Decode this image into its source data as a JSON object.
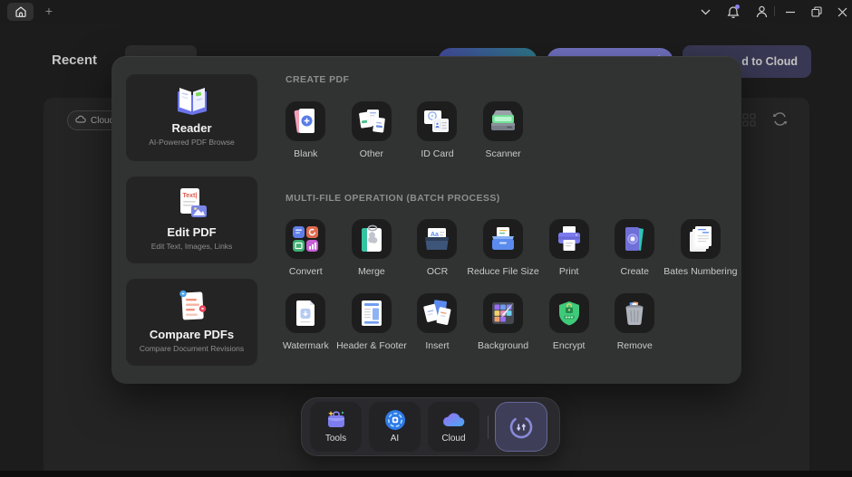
{
  "titlebar": {
    "plus_label": "+",
    "icons": [
      "home-icon",
      "chevron-down-icon",
      "notifications-bell-icon",
      "account-icon",
      "minimize-icon",
      "restore-icon",
      "close-icon"
    ]
  },
  "page": {
    "title": "Recent",
    "cloud_filter_label": "Cloud",
    "upload_to_cloud_button_partial_label": "d to Cloud"
  },
  "modal": {
    "cards": [
      {
        "title": "Reader",
        "subtitle": "AI-Powered PDF Browse",
        "icon": "reader-icon"
      },
      {
        "title": "Edit PDF",
        "subtitle": "Edit Text, Images, Links",
        "icon": "edit-pdf-icon"
      },
      {
        "title": "Compare PDFs",
        "subtitle": "Compare Document Revisions",
        "icon": "compare-pdfs-icon"
      }
    ],
    "create_section": {
      "header": "CREATE PDF",
      "items": [
        {
          "label": "Blank",
          "icon": "blank-icon"
        },
        {
          "label": "Other",
          "icon": "other-icon"
        },
        {
          "label": "ID Card",
          "icon": "id-card-icon"
        },
        {
          "label": "Scanner",
          "icon": "scanner-icon"
        }
      ]
    },
    "batch_section": {
      "header": "MULTI-FILE OPERATION (BATCH PROCESS)",
      "row1": [
        {
          "label": "Convert",
          "icon": "convert-icon"
        },
        {
          "label": "Merge",
          "icon": "merge-icon"
        },
        {
          "label": "OCR",
          "icon": "ocr-icon"
        },
        {
          "label": "Reduce File Size",
          "icon": "reduce-file-size-icon"
        },
        {
          "label": "Print",
          "icon": "print-icon"
        },
        {
          "label": "Create",
          "icon": "create-icon"
        },
        {
          "label": "Bates Numbering",
          "icon": "bates-numbering-icon"
        }
      ],
      "row2": [
        {
          "label": "Watermark",
          "icon": "watermark-icon"
        },
        {
          "label": "Header & Footer",
          "icon": "header-footer-icon"
        },
        {
          "label": "Insert",
          "icon": "insert-icon"
        },
        {
          "label": "Background",
          "icon": "background-icon"
        },
        {
          "label": "Encrypt",
          "icon": "encrypt-icon"
        },
        {
          "label": "Remove",
          "icon": "remove-icon"
        }
      ]
    }
  },
  "dock": {
    "items": [
      {
        "label": "Tools",
        "icon": "tools-icon"
      },
      {
        "label": "AI",
        "icon": "ai-icon"
      },
      {
        "label": "Cloud",
        "icon": "cloud-icon"
      }
    ],
    "sync_button_icon": "sync-icon"
  },
  "colors": {
    "accent_purple": "#8e8ef3",
    "teal_button_gradient_start": "#5560c8",
    "teal_button_gradient_end": "#3b98ae",
    "navy_button": "#464769",
    "notification_dot": "#8b7ff0",
    "encrypt_green": "#3fca7a",
    "modal_bg": "#313232",
    "page_bg": "#242424"
  }
}
